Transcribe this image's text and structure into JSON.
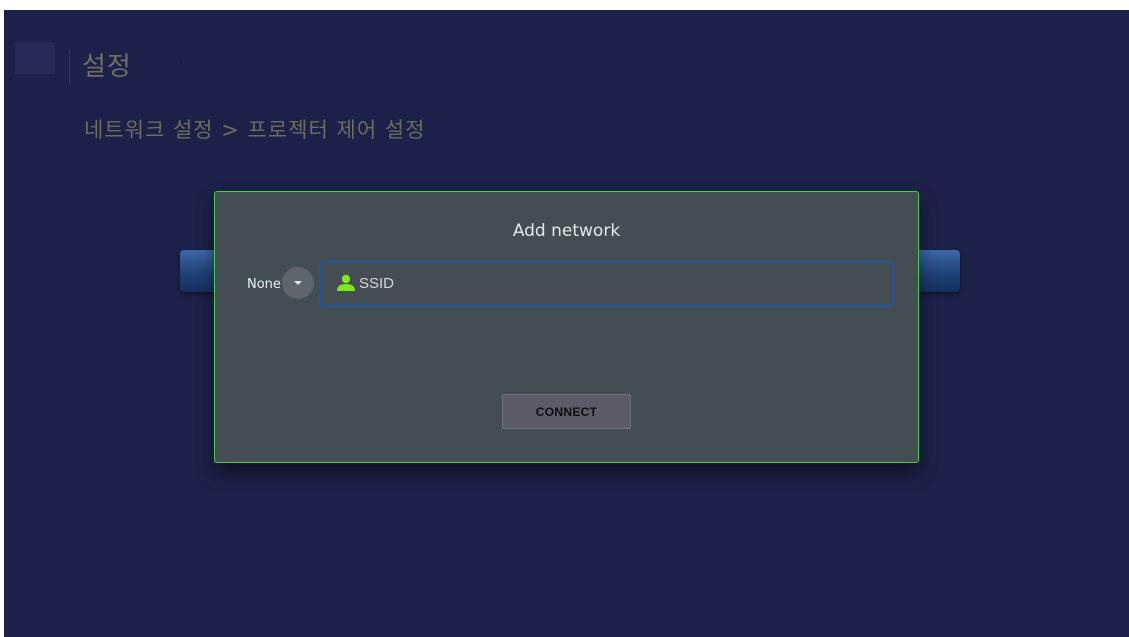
{
  "header": {
    "title": "설정",
    "breadcrumb": "네트워크 설정 > 프로젝터 제어 설정"
  },
  "dialog": {
    "title": "Add network",
    "security": {
      "selected": "None"
    },
    "ssid": {
      "placeholder": "SSID",
      "value": "",
      "icon": "user-icon"
    },
    "connect_label": "CONNECT"
  },
  "colors": {
    "background": "#1d2048",
    "dialog_bg": "#444d51",
    "dialog_border": "#3fd14a",
    "field_border": "#1f55a3",
    "icon_accent": "#7ee81e"
  }
}
